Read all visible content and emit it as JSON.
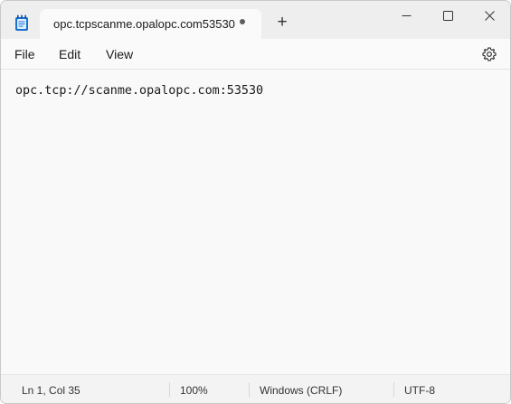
{
  "tab": {
    "title": "opc.tcpscanme.opalopc.com53530"
  },
  "menu": {
    "file": "File",
    "edit": "Edit",
    "view": "View"
  },
  "editor": {
    "content": "opc.tcp://scanme.opalopc.com:53530"
  },
  "status": {
    "position": "Ln 1, Col 35",
    "zoom": "100%",
    "line_ending": "Windows (CRLF)",
    "encoding": "UTF-8"
  },
  "new_tab_glyph": "+",
  "icons": [
    "notepad-icon",
    "unsaved-dot-icon",
    "plus-icon",
    "minimize-icon",
    "maximize-icon",
    "close-icon",
    "gear-icon"
  ]
}
